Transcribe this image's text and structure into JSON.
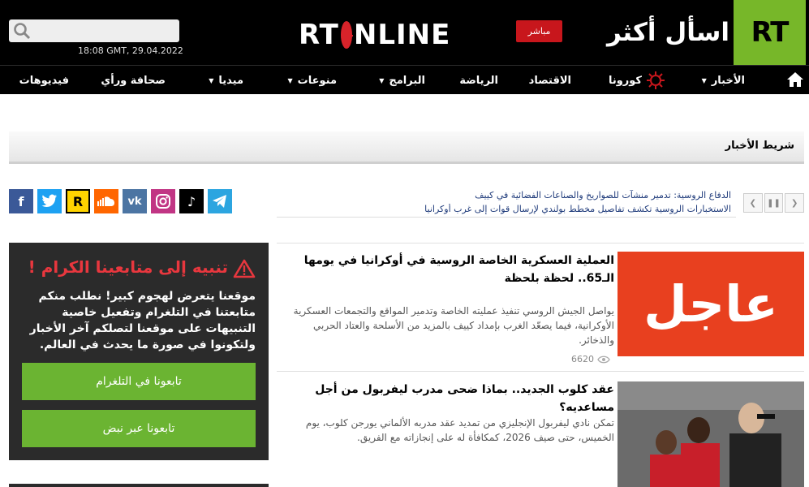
{
  "header": {
    "logo_text": "RT",
    "slogan": "اسأل أكثر",
    "live_label": "مباشر",
    "brand_prefix": "RT",
    "brand_suffix": "NLINE",
    "search_placeholder": "",
    "datetime": "18:08 GMT, 29.04.2022"
  },
  "nav": {
    "items": [
      {
        "label": "الأخبار",
        "dropdown": true
      },
      {
        "label": "كورونا",
        "dropdown": false
      },
      {
        "label": "الاقتصاد",
        "dropdown": false
      },
      {
        "label": "الرياضة",
        "dropdown": false
      },
      {
        "label": "البرامج",
        "dropdown": true
      },
      {
        "label": "منوعات",
        "dropdown": true
      },
      {
        "label": "ميديا",
        "dropdown": true
      },
      {
        "label": "صحافة ورأي",
        "dropdown": true
      },
      {
        "label": "فيديوهات",
        "dropdown": false
      }
    ]
  },
  "ticker": {
    "title": "شريط الأخبار",
    "line1_source": "الدفاع الروسية:",
    "line1_text": "تدمير منشآت للصواريخ والصناعات الفضائية في كييف",
    "line2_text": "الاستخبارات الروسية تكشف تفاصيل مخطط بولندي لإرسال قوات إلى غرب أوكرانيا"
  },
  "social": {
    "icons": [
      "facebook-icon",
      "twitter-icon",
      "rutube-icon",
      "soundcloud-icon",
      "vk-icon",
      "instagram-icon",
      "tiktok-icon",
      "telegram-icon"
    ]
  },
  "warning": {
    "title": "تنبيه إلى متابعينا الكرام !",
    "text": "موقعنا يتعرض لهجوم كبير! نطلب منكم متابعتنا في التلغرام وتفعيل خاصية التنبيهات على موقعنا لتصلكم آخر الأخبار ولتكونوا في صورة ما يحدث في العالم.",
    "btn_telegram": "تابعونا في التلغرام",
    "btn_push": "تابعونا عبر نبض"
  },
  "articles": [
    {
      "badge": "عاجل",
      "title": "العملية العسكرية الخاصة الروسية في أوكرانيا في يومها الـ65.. لحظة بلحظة",
      "desc": "يواصل الجيش الروسي تنفيذ عمليته الخاصة وتدمير المواقع والتجمعات العسكرية الأوكرانية، فيما يصعّد الغرب بإمداد كييف بالمزيد من الأسلحة والعتاد الحربي والذخائر.",
      "views": "6620"
    },
    {
      "title": "عقد كلوب الجديد.. بماذا ضحى مدرب ليفربول من أجل مساعديه؟",
      "desc": "تمكن نادي ليفربول الإنجليزي من تمديد عقد مدربه الألماني يورجن كلوب، يوم الخميس، حتى صيف 2026، كمكافأة له على إنجازاته مع الفريق."
    }
  ],
  "colors": {
    "brand_green": "#77b729",
    "live_red": "#c8161c",
    "warning_red": "#e8373e",
    "button_green": "#6bb432"
  }
}
